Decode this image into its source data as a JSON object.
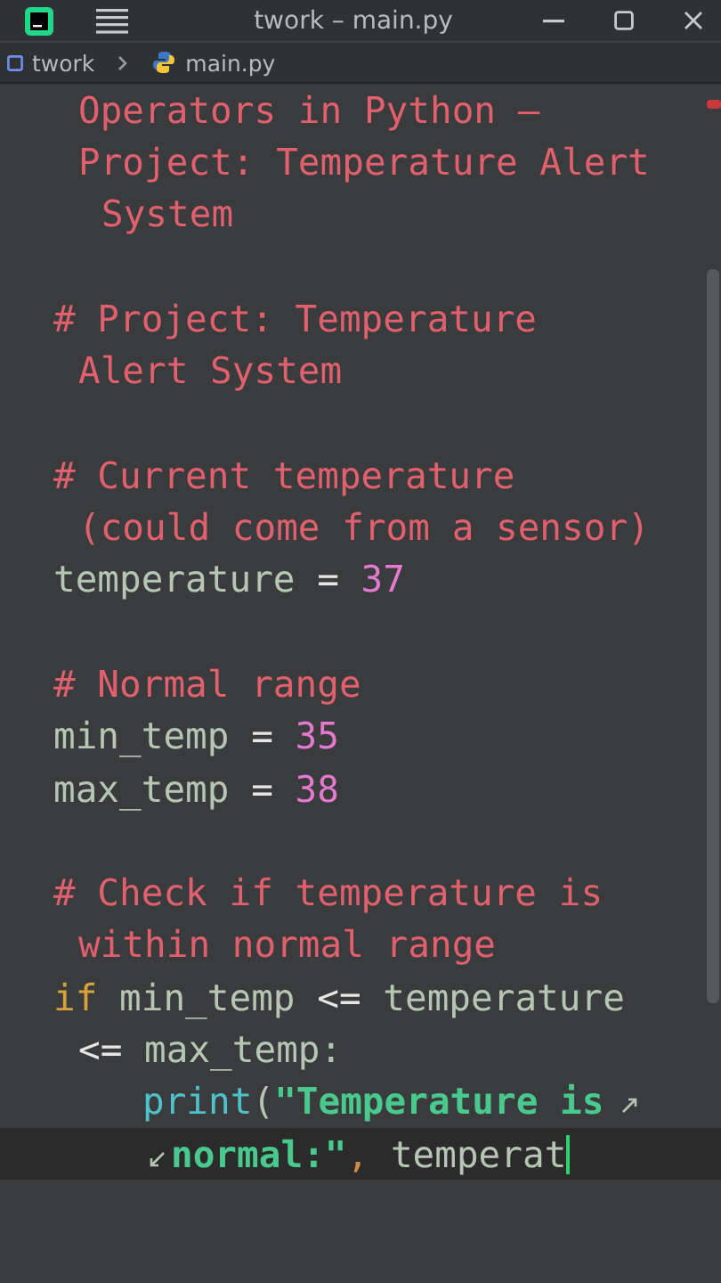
{
  "title_bar": {
    "title": "twork – main.py"
  },
  "breadcrumb": [
    {
      "kind": "folder",
      "label": "twork"
    },
    {
      "kind": "python",
      "label": "main.py"
    }
  ],
  "editor": {
    "lines": [
      {
        "kind": "wrap",
        "current": false,
        "tokens": [
          {
            "kind": "comment",
            "text": "Operators in Python —"
          }
        ]
      },
      {
        "kind": "wrap",
        "current": false,
        "tokens": [
          {
            "kind": "comment",
            "text": "Project: Temperature Alert"
          }
        ]
      },
      {
        "kind": "wrap2",
        "current": false,
        "tokens": [
          {
            "kind": "comment",
            "text": "System"
          }
        ]
      },
      {
        "kind": "blank",
        "current": false
      },
      {
        "kind": "line",
        "current": false,
        "tokens": [
          {
            "kind": "comment",
            "text": "# Project: Temperature"
          }
        ]
      },
      {
        "kind": "wrap",
        "current": false,
        "tokens": [
          {
            "kind": "comment",
            "text": "Alert System"
          }
        ]
      },
      {
        "kind": "blank",
        "current": false
      },
      {
        "kind": "line",
        "current": false,
        "tokens": [
          {
            "kind": "comment",
            "text": "# Current temperature"
          }
        ]
      },
      {
        "kind": "wrap",
        "current": false,
        "tokens": [
          {
            "kind": "comment",
            "text": "(could come from a sensor)"
          }
        ]
      },
      {
        "kind": "line",
        "current": false,
        "tokens": [
          {
            "kind": "ident",
            "text": "temperature "
          },
          {
            "kind": "op",
            "text": "= "
          },
          {
            "kind": "number",
            "text": "37"
          }
        ]
      },
      {
        "kind": "blank",
        "current": false
      },
      {
        "kind": "line",
        "current": false,
        "tokens": [
          {
            "kind": "comment",
            "text": "# Normal range"
          }
        ]
      },
      {
        "kind": "line",
        "current": false,
        "tokens": [
          {
            "kind": "ident",
            "text": "min_temp "
          },
          {
            "kind": "op",
            "text": "= "
          },
          {
            "kind": "number",
            "text": "35"
          }
        ]
      },
      {
        "kind": "line",
        "current": false,
        "tokens": [
          {
            "kind": "ident",
            "text": "max_temp "
          },
          {
            "kind": "op",
            "text": "= "
          },
          {
            "kind": "number",
            "text": "38"
          }
        ]
      },
      {
        "kind": "blank",
        "current": false
      },
      {
        "kind": "line",
        "current": false,
        "tokens": [
          {
            "kind": "comment",
            "text": "# Check if temperature is"
          }
        ]
      },
      {
        "kind": "wrap",
        "current": false,
        "tokens": [
          {
            "kind": "comment",
            "text": "within normal range"
          }
        ]
      },
      {
        "kind": "line",
        "current": false,
        "tokens": [
          {
            "kind": "keyword",
            "text": "if "
          },
          {
            "kind": "ident",
            "text": "min_temp "
          },
          {
            "kind": "op",
            "text": "<= "
          },
          {
            "kind": "ident",
            "text": "temperature"
          }
        ]
      },
      {
        "kind": "wrap",
        "current": false,
        "tokens": [
          {
            "kind": "op",
            "text": "<= "
          },
          {
            "kind": "ident",
            "text": "max_temp:"
          }
        ]
      },
      {
        "kind": "body",
        "current": false,
        "tokens": [
          {
            "kind": "builtin",
            "text": "print"
          },
          {
            "kind": "ident",
            "text": "("
          },
          {
            "kind": "string",
            "text": "\"Temperature is"
          }
        ]
      },
      {
        "kind": "body-wrap",
        "current": true,
        "tokens": [
          {
            "kind": "string",
            "text": "normal:\""
          },
          {
            "kind": "punct",
            "text": ", "
          },
          {
            "kind": "ident",
            "text": "temperat"
          }
        ]
      }
    ]
  }
}
